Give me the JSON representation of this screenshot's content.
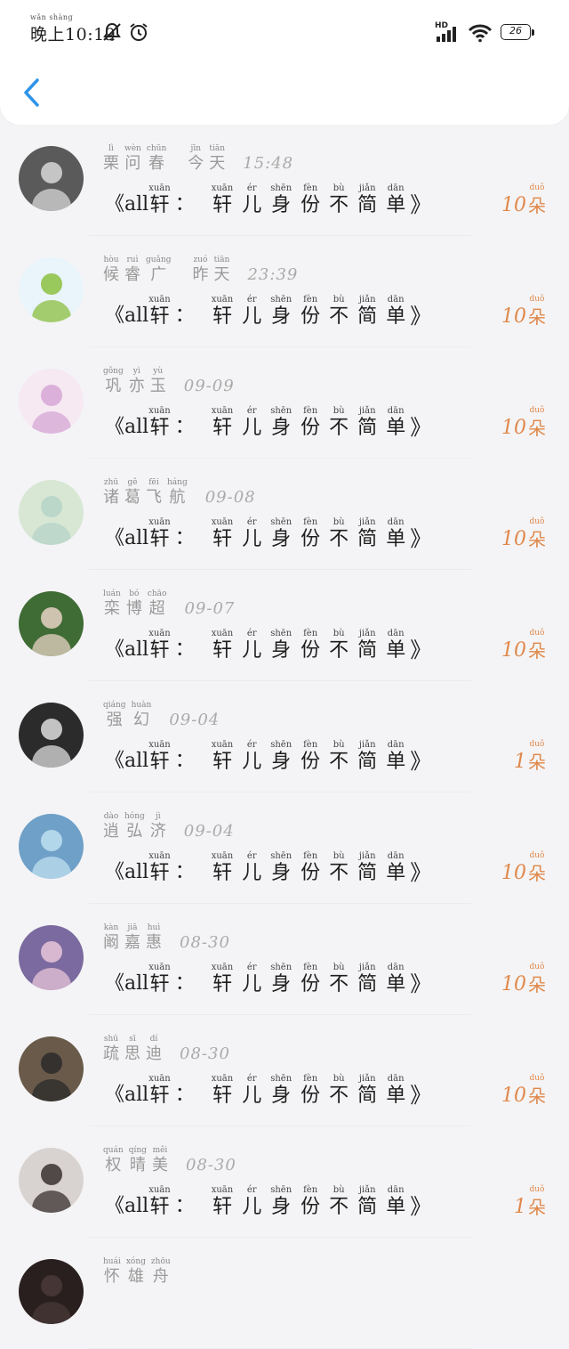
{
  "status": {
    "time_ruby": {
      "text": "晚上",
      "pinyin": "wǎn shàng"
    },
    "time": "10:19",
    "battery": "26",
    "network_label": "HD"
  },
  "header": {
    "back_icon": "chevron-left-icon"
  },
  "accent_color": "#e0884a",
  "gift": {
    "prefix": "《all",
    "first_char": {
      "hz": "轩",
      "py": "xuān"
    },
    "colon": "：",
    "chars": [
      {
        "hz": "轩",
        "py": "xuān"
      },
      {
        "hz": "儿",
        "py": "ér"
      },
      {
        "hz": "身",
        "py": "shēn"
      },
      {
        "hz": "份",
        "py": "fèn"
      },
      {
        "hz": "不",
        "py": "bù"
      },
      {
        "hz": "简",
        "py": "jiǎn"
      },
      {
        "hz": "单",
        "py": "dān"
      }
    ],
    "suffix": "》",
    "unit": {
      "hz": "朵",
      "py": "duǒ"
    }
  },
  "rows": [
    {
      "name": [
        {
          "hz": "栗",
          "py": "lì"
        },
        {
          "hz": "问",
          "py": "wèn"
        },
        {
          "hz": "春",
          "py": "chūn"
        }
      ],
      "day": [
        {
          "hz": "今",
          "py": "jīn"
        },
        {
          "hz": "天",
          "py": "tiān"
        }
      ],
      "time": "15:48",
      "count": "10"
    },
    {
      "name": [
        {
          "hz": "候",
          "py": "hòu"
        },
        {
          "hz": "睿",
          "py": "ruì"
        },
        {
          "hz": "广",
          "py": "guǎng"
        }
      ],
      "day": [
        {
          "hz": "昨",
          "py": "zuó"
        },
        {
          "hz": "天",
          "py": "tiān"
        }
      ],
      "time": "23:39",
      "count": "10"
    },
    {
      "name": [
        {
          "hz": "巩",
          "py": "gǒng"
        },
        {
          "hz": "亦",
          "py": "yì"
        },
        {
          "hz": "玉",
          "py": "yù"
        }
      ],
      "day": [],
      "time": "09-09",
      "count": "10"
    },
    {
      "name": [
        {
          "hz": "诸",
          "py": "zhū"
        },
        {
          "hz": "葛",
          "py": "gě"
        },
        {
          "hz": "飞",
          "py": "fēi"
        },
        {
          "hz": "航",
          "py": "háng"
        }
      ],
      "day": [],
      "time": "09-08",
      "count": "10"
    },
    {
      "name": [
        {
          "hz": "栾",
          "py": "luán"
        },
        {
          "hz": "博",
          "py": "bó"
        },
        {
          "hz": "超",
          "py": "chāo"
        }
      ],
      "day": [],
      "time": "09-07",
      "count": "10"
    },
    {
      "name": [
        {
          "hz": "强",
          "py": "qiáng"
        },
        {
          "hz": "幻",
          "py": "huàn"
        }
      ],
      "day": [],
      "time": "09-04",
      "count": "1"
    },
    {
      "name": [
        {
          "hz": "逍",
          "py": "dào"
        },
        {
          "hz": "弘",
          "py": "hóng"
        },
        {
          "hz": "济",
          "py": "jì"
        }
      ],
      "day": [],
      "time": "09-04",
      "count": "10"
    },
    {
      "name": [
        {
          "hz": "阚",
          "py": "kàn"
        },
        {
          "hz": "嘉",
          "py": "jiā"
        },
        {
          "hz": "惠",
          "py": "huì"
        }
      ],
      "day": [],
      "time": "08-30",
      "count": "10"
    },
    {
      "name": [
        {
          "hz": "疏",
          "py": "shū"
        },
        {
          "hz": "思",
          "py": "sī"
        },
        {
          "hz": "迪",
          "py": "dí"
        }
      ],
      "day": [],
      "time": "08-30",
      "count": "10"
    },
    {
      "name": [
        {
          "hz": "权",
          "py": "quán"
        },
        {
          "hz": "晴",
          "py": "qíng"
        },
        {
          "hz": "美",
          "py": "měi"
        }
      ],
      "day": [],
      "time": "08-30",
      "count": "1"
    },
    {
      "name": [
        {
          "hz": "怀",
          "py": "huái"
        },
        {
          "hz": "雄",
          "py": "xóng"
        },
        {
          "hz": "舟",
          "py": "zhōu"
        }
      ],
      "day": [],
      "time": "",
      "count": ""
    }
  ],
  "avatars": [
    {
      "bg": "#5a5a5a",
      "fg": "#d8d8d8",
      "icon": "woman-bw-photo"
    },
    {
      "bg": "#eaf4fb",
      "fg": "#8bbf3f",
      "icon": "cartoon-boy"
    },
    {
      "bg": "#f6e9f2",
      "fg": "#d6a6d6",
      "icon": "anime-girl"
    },
    {
      "bg": "#d8e7d4",
      "fg": "#b6d3c8",
      "icon": "cat-photo"
    },
    {
      "bg": "#3f6b35",
      "fg": "#e8d2c4",
      "icon": "girl-in-forest"
    },
    {
      "bg": "#2b2b2b",
      "fg": "#dedede",
      "icon": "man-smoking"
    },
    {
      "bg": "#6fa0c8",
      "fg": "#bfe0f0",
      "icon": "bottle-sea"
    },
    {
      "bg": "#7b6aa0",
      "fg": "#e8c6d8",
      "icon": "girl-lavender"
    },
    {
      "bg": "#6a5a4a",
      "fg": "#2a2a2a",
      "icon": "boy-photo"
    },
    {
      "bg": "#d8d3d0",
      "fg": "#3a3030",
      "icon": "young-man"
    },
    {
      "bg": "#2a1f1f",
      "fg": "#4a3a3a",
      "icon": "dark-photo"
    }
  ]
}
